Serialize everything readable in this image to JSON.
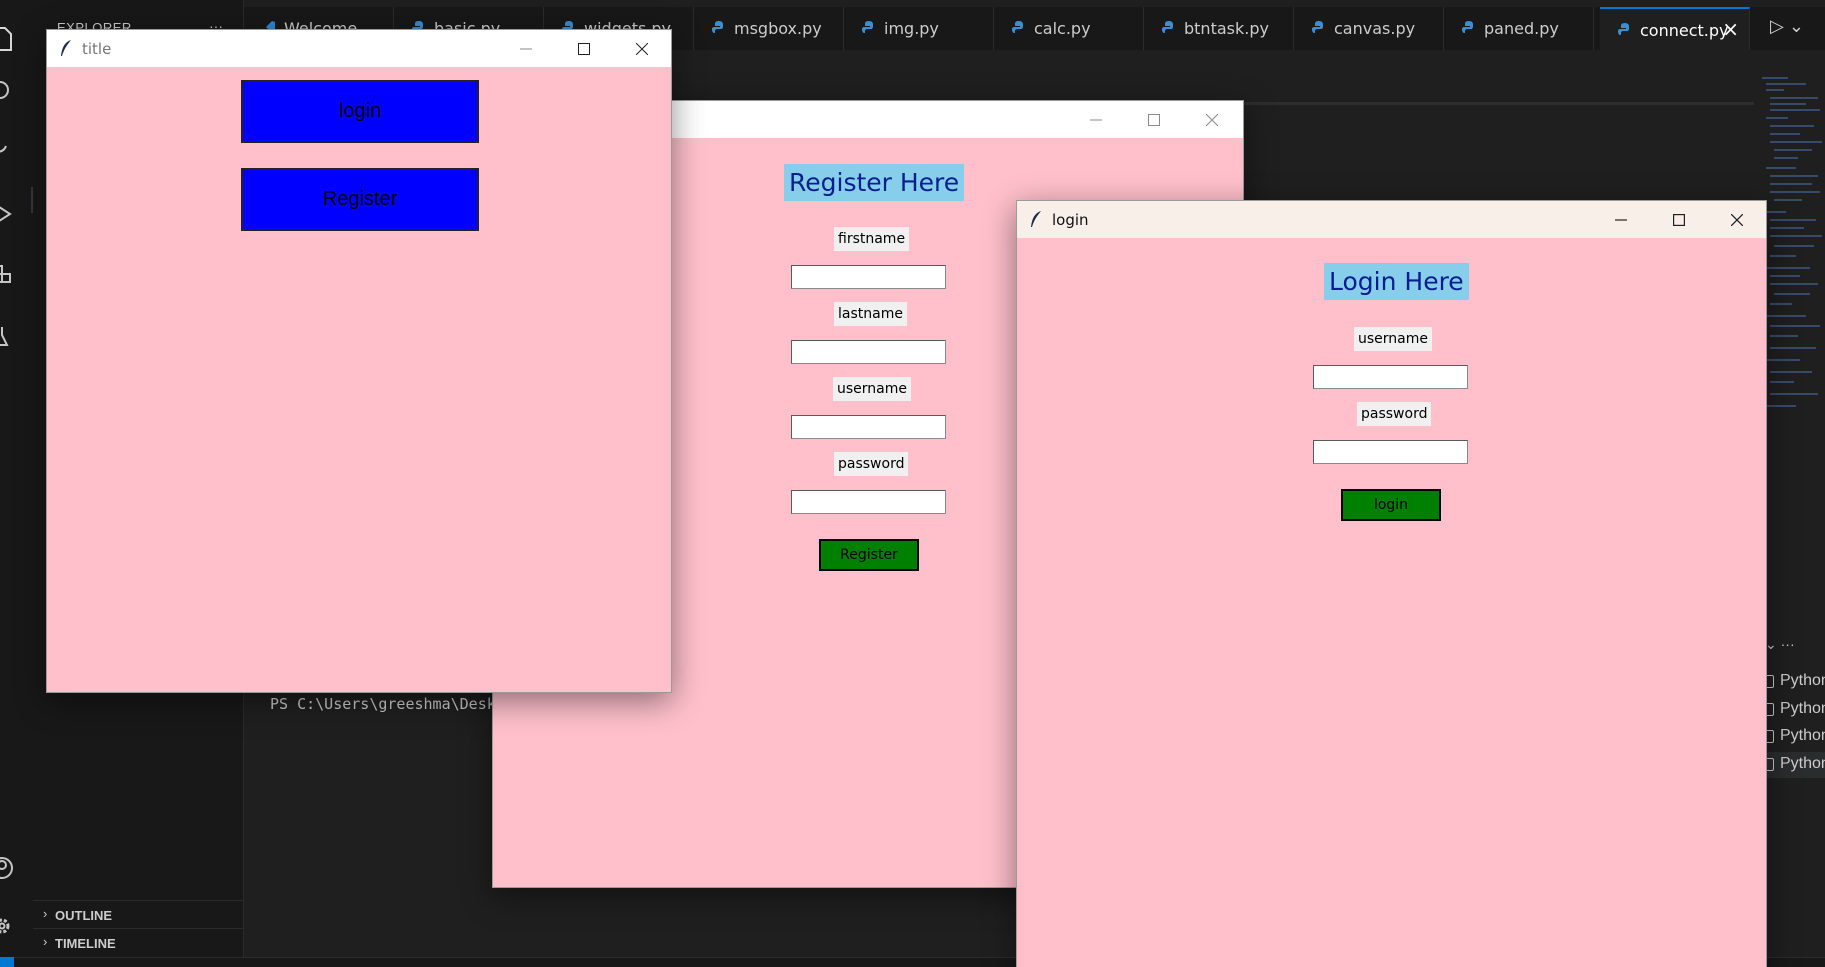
{
  "vscode": {
    "sidebar_title": "EXPLORER",
    "sidebar_more": "···",
    "sections": [
      {
        "label": "OUTLINE"
      },
      {
        "label": "TIMELINE"
      }
    ],
    "tabs": [
      {
        "label": "Welcome"
      },
      {
        "label": "basic.py"
      },
      {
        "label": "widgets.py"
      },
      {
        "label": "msgbox.py"
      },
      {
        "label": "img.py"
      },
      {
        "label": "calc.py"
      },
      {
        "label": "btntask.py"
      },
      {
        "label": "canvas.py"
      },
      {
        "label": "paned.py"
      },
      {
        "label": "connect.py"
      }
    ],
    "terminal_prompt": "PS C:\\Users\\greeshma\\Desk",
    "panel_more": "···",
    "terminals": [
      {
        "label": "Python"
      },
      {
        "label": "Python"
      },
      {
        "label": "Python"
      },
      {
        "label": "Python"
      }
    ],
    "colors": {
      "accent": "#0078d4",
      "python_icon": "#3b8ed0"
    }
  },
  "windows": {
    "title": {
      "title": "title",
      "login_button": "login",
      "register_button": "Register",
      "bg": "#ffc0cb",
      "button_color": "#0000ff"
    },
    "register": {
      "heading": "Register Here",
      "fields": [
        {
          "label": "firstname",
          "value": ""
        },
        {
          "label": "lastname",
          "value": ""
        },
        {
          "label": "username",
          "value": ""
        },
        {
          "label": "password",
          "value": ""
        }
      ],
      "submit": "Register",
      "button_color": "#008000"
    },
    "login": {
      "title": "login",
      "heading": "Login Here",
      "fields": [
        {
          "label": "username",
          "value": ""
        },
        {
          "label": "password",
          "value": ""
        }
      ],
      "submit": "login",
      "heading_bg": "#87ceeb"
    }
  }
}
